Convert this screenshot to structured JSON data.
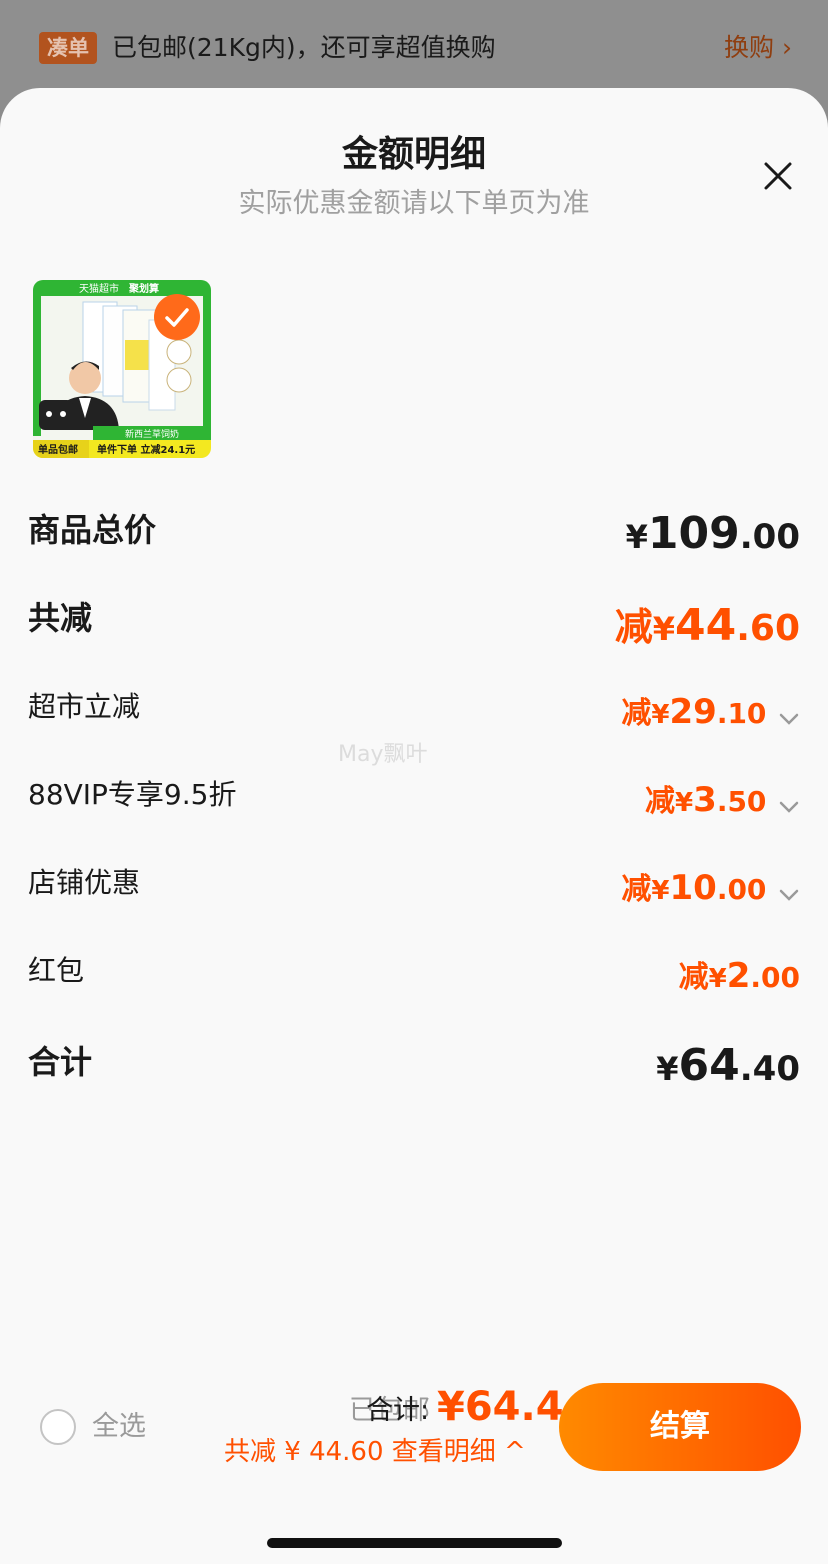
{
  "topbar": {
    "tag": "凑单",
    "text": "已包邮(21Kg内)，还可享超值换购",
    "link": "换购 ›"
  },
  "sheet": {
    "title": "金额明细",
    "subtitle": "实际优惠金额请以下单页为准"
  },
  "product_image": {
    "banner_left": "天猫超市",
    "banner_right": "聚划算",
    "product_label": "新西兰草饲奶",
    "badge_left": "单品包邮",
    "badge_right": "单件下单 立减24.1元"
  },
  "rows": [
    {
      "label": "商品总价",
      "yen": "¥",
      "int": "109",
      "dec": ".00",
      "prefix": ""
    },
    {
      "label": "共减",
      "yen": "¥",
      "int": "44",
      "dec": ".60",
      "prefix": "减"
    },
    {
      "label": "超市立减",
      "yen": "¥",
      "int": "29",
      "dec": ".10",
      "prefix": "减"
    },
    {
      "label": "88VIP专享9.5折",
      "yen": "¥",
      "int": "3",
      "dec": ".50",
      "prefix": "减"
    },
    {
      "label": "店铺优惠",
      "yen": "¥",
      "int": "10",
      "dec": ".00",
      "prefix": "减"
    },
    {
      "label": "红包",
      "yen": "¥",
      "int": "2",
      "dec": ".00",
      "prefix": "减"
    },
    {
      "label": "合计",
      "yen": "¥",
      "int": "64",
      "dec": ".40",
      "prefix": ""
    }
  ],
  "watermark": "May飘叶",
  "bottom": {
    "select_all": "全选",
    "free_shipping": "已包邮",
    "sum_label": "合计:",
    "sum_value": "¥64.4",
    "reduce_line": "共减 ¥ 44.60  查看明细 ^",
    "checkout": "结算"
  },
  "colors": {
    "accent": "#ff5000",
    "text": "#1a1a1a",
    "muted": "#9a9a9a"
  }
}
